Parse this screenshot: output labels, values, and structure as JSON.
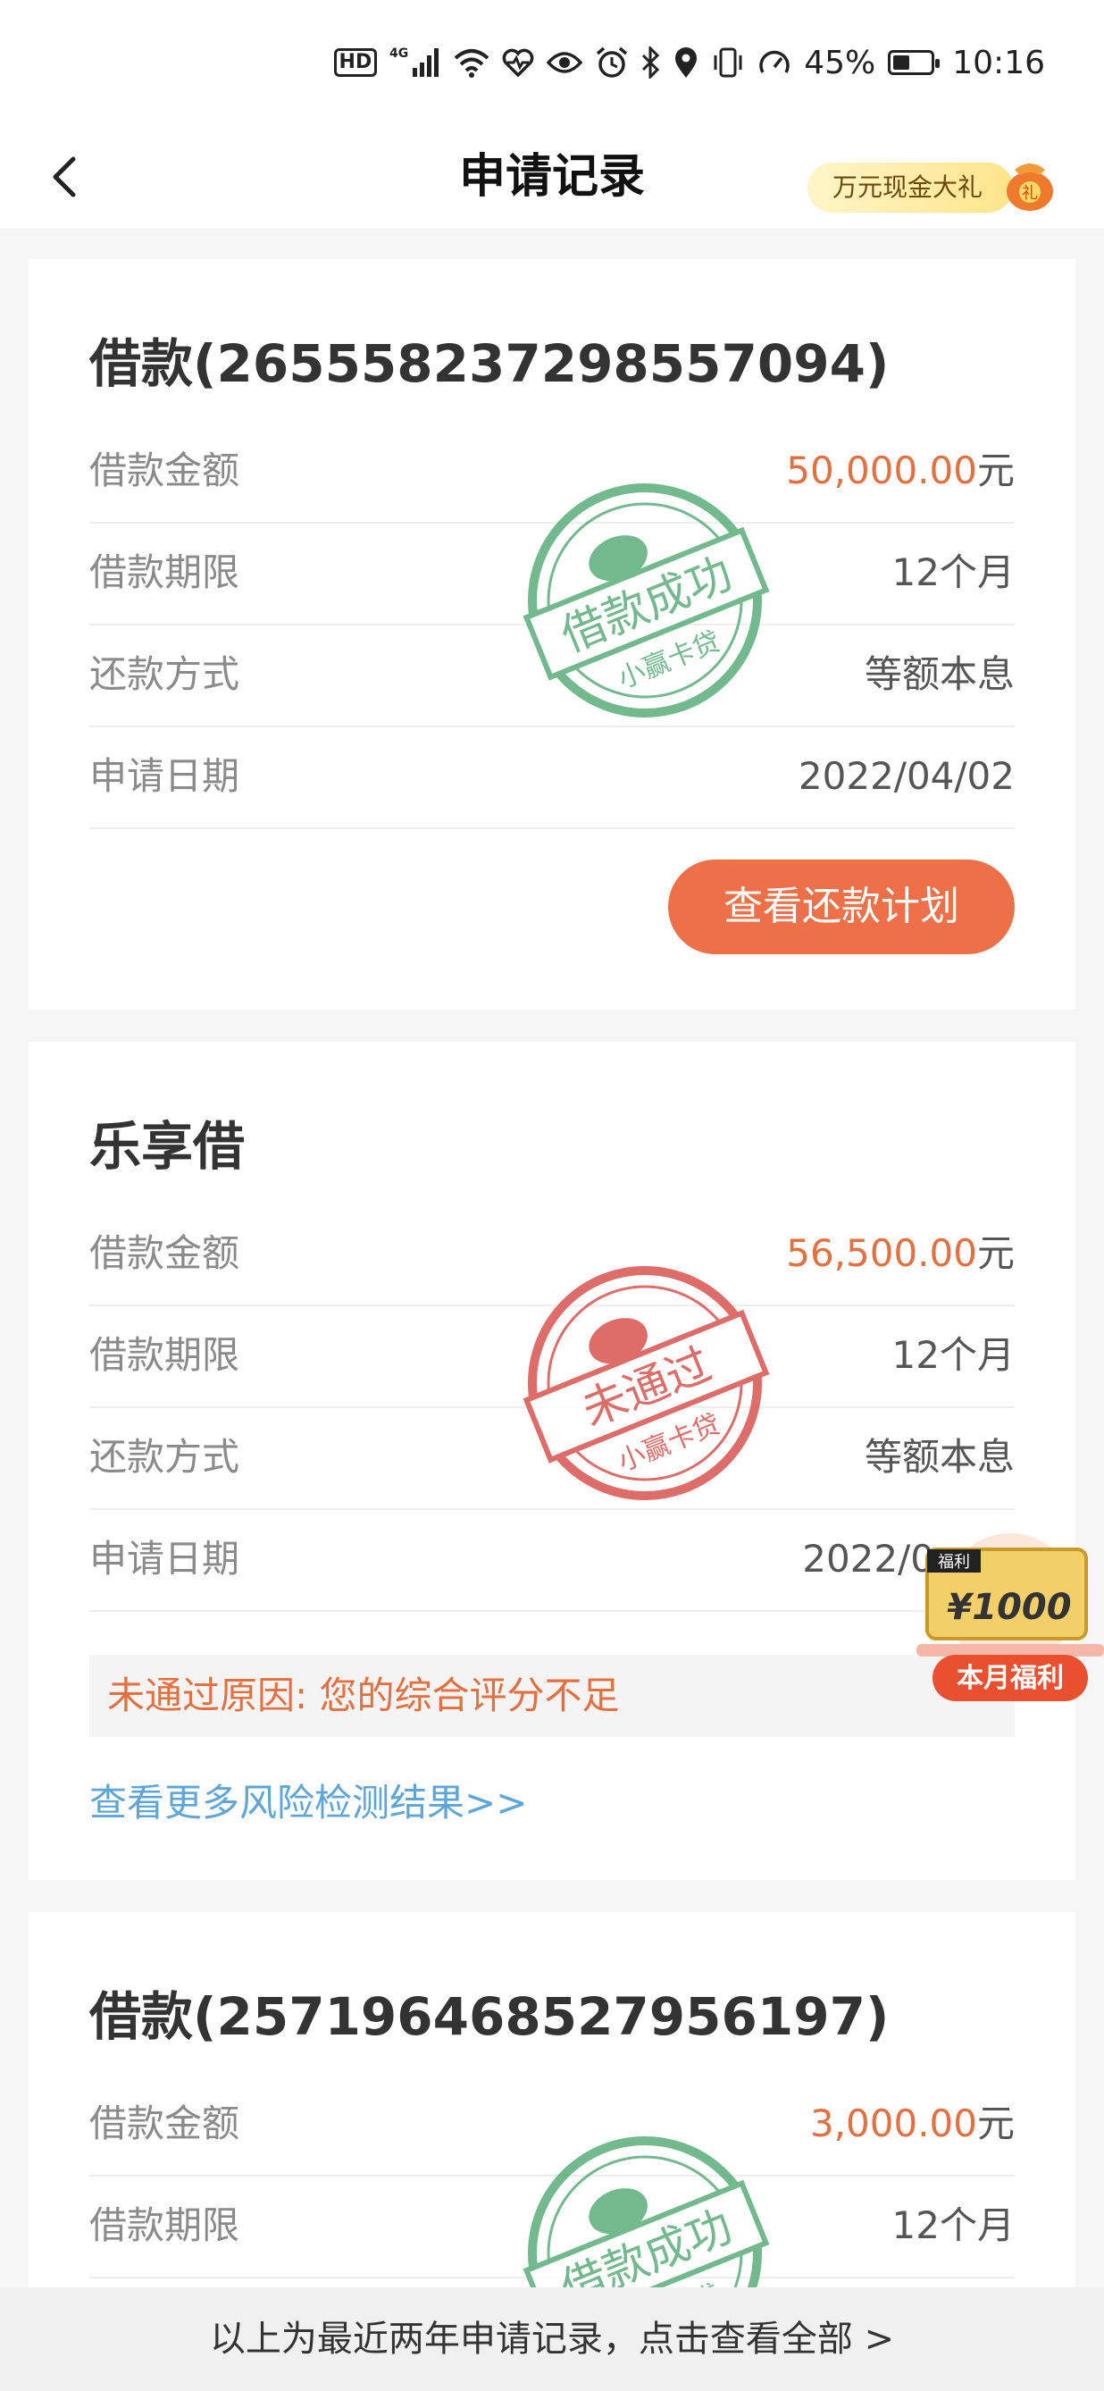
{
  "status_bar": {
    "hd": "HD",
    "network": "4G",
    "battery": "45%",
    "time": "10:16",
    "battery_level": 0.45,
    "icons": [
      "hd-icon",
      "signal-icon",
      "wifi-icon",
      "heart-icon",
      "eye-icon",
      "alarm-icon",
      "bluetooth-icon",
      "location-icon",
      "vibrate-icon",
      "speedometer-icon",
      "battery-icon"
    ]
  },
  "nav": {
    "title": "申请记录",
    "promo": "万元现金大礼",
    "promo_icon": "gift-bag-icon",
    "promo_bag_text": "礼"
  },
  "cards": [
    {
      "title": "借款(2655582372985570​94)",
      "rows": [
        {
          "label": "借款金额",
          "value": "50,000.00",
          "unit": "元"
        },
        {
          "label": "借款期限",
          "value": "12个月"
        },
        {
          "label": "还款方式",
          "value": "等额本息"
        },
        {
          "label": "申请日期",
          "value": "2022/04/02"
        }
      ],
      "stamp": {
        "text": "借款成功",
        "sub": "小赢卡贷",
        "color": "#5aae7a"
      },
      "button": "查看还款计划"
    },
    {
      "title": "乐享借",
      "rows": [
        {
          "label": "借款金额",
          "value": "56,500.00",
          "unit": "元"
        },
        {
          "label": "借款期限",
          "value": "12个月"
        },
        {
          "label": "还款方式",
          "value": "等额本息"
        },
        {
          "label": "申请日期",
          "value": "2022/0"
        }
      ],
      "stamp": {
        "text": "未通过",
        "sub": "小赢卡贷",
        "color": "#d9534f"
      },
      "reject_reason": "未通过原因: 您的综合评分不足",
      "more_link": "查看更多风险检测结果>>"
    },
    {
      "title": "借款(257196468527956197)",
      "rows": [
        {
          "label": "借款金额",
          "value": "3,000.00",
          "unit": "元"
        },
        {
          "label": "借款期限",
          "value": "12个月"
        }
      ],
      "stamp": {
        "text": "借款成功",
        "sub": "小赢卡贷",
        "color": "#5aae7a"
      }
    }
  ],
  "welfare": {
    "tag": "福利",
    "amount": "¥1000",
    "label": "本月福利"
  },
  "footer": "以上为最近两年申请记录，点击查看全部 >"
}
